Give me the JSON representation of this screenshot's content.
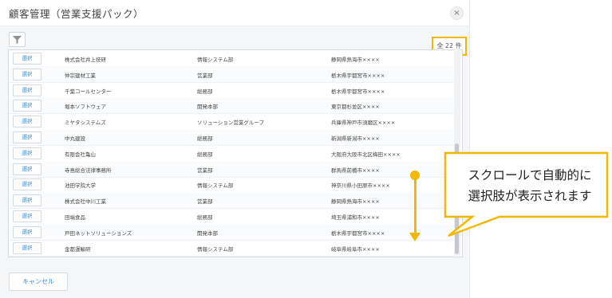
{
  "dialog": {
    "title": "顧客管理（営業支援パック）",
    "close_label": "×",
    "count_label": "全 22 件",
    "cancel_label": "キャンセル"
  },
  "table": {
    "select_label": "選択",
    "rows": [
      {
        "name": "株式会社井上技研",
        "dept": "情報システム部",
        "addr": "静岡県熱海市××××"
      },
      {
        "name": "仲宗建材工業",
        "dept": "営業部",
        "addr": "栃木県宇都宮市××××"
      },
      {
        "name": "千葉コールセンター",
        "dept": "総務部",
        "addr": "栃木県宇都宮市××××"
      },
      {
        "name": "堀本ソフトウェア",
        "dept": "開発本部",
        "addr": "東京都杉並区××××"
      },
      {
        "name": "ミヤタシステムズ",
        "dept": "ソリューション営業グループ",
        "addr": "兵庫県神戸市須磨区××××"
      },
      {
        "name": "中丸建設",
        "dept": "総務部",
        "addr": "新潟県新潟市××××"
      },
      {
        "name": "有限会社亀山",
        "dept": "総務部",
        "addr": "大阪府大阪市北区梅田××××"
      },
      {
        "name": "寺島総合法律事務所",
        "dept": "営業部",
        "addr": "群馬県前橋市××××"
      },
      {
        "name": "池田学院大学",
        "dept": "情報システム部",
        "addr": "神奈川県小田原市××××"
      },
      {
        "name": "株式会社中川工業",
        "dept": "営業部",
        "addr": "静岡県熱海市××××"
      },
      {
        "name": "田端食品",
        "dept": "総務部",
        "addr": "埼玉県浦和市××××"
      },
      {
        "name": "戸田ネットソリューションズ",
        "dept": "開発本部",
        "addr": "栃木県宇都宮市××××"
      },
      {
        "name": "金都運輸研",
        "dept": "情報システム部",
        "addr": "岐阜県岐阜市××××"
      }
    ]
  },
  "callout": {
    "line1": "スクロールで自動的に",
    "line2": "選択肢が表示されます"
  },
  "colors": {
    "accent": "#f5b800",
    "link": "#3a8fd8"
  },
  "icons": {
    "filter": "filter-icon",
    "close": "close-icon"
  }
}
